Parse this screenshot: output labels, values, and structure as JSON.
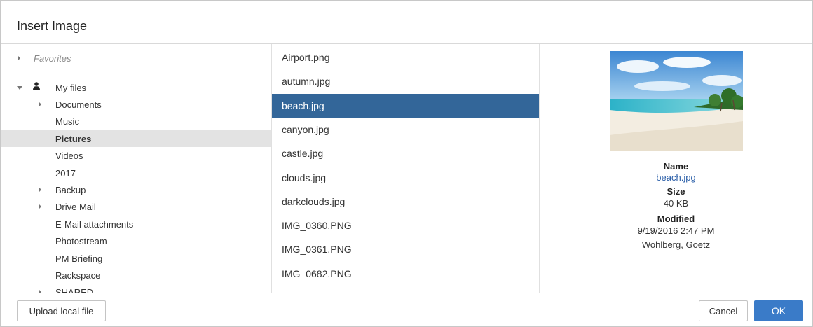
{
  "dialog": {
    "title": "Insert Image"
  },
  "tree": {
    "favorites": "Favorites",
    "my_files": "My files",
    "items": [
      {
        "label": "Documents",
        "caret": true
      },
      {
        "label": "Music",
        "caret": false
      },
      {
        "label": "Pictures",
        "caret": false,
        "selected": true
      },
      {
        "label": "Videos",
        "caret": false
      },
      {
        "label": "2017",
        "caret": false
      },
      {
        "label": "Backup",
        "caret": true
      },
      {
        "label": "Drive Mail",
        "caret": true
      },
      {
        "label": "E-Mail attachments",
        "caret": false
      },
      {
        "label": "Photostream",
        "caret": false
      },
      {
        "label": "PM Briefing",
        "caret": false
      },
      {
        "label": "Rackspace",
        "caret": false
      },
      {
        "label": "SHARED",
        "caret": true
      }
    ]
  },
  "files": [
    "Airport.png",
    "autumn.jpg",
    "beach.jpg",
    "canyon.jpg",
    "castle.jpg",
    "clouds.jpg",
    "darkclouds.jpg",
    "IMG_0360.PNG",
    "IMG_0361.PNG",
    "IMG_0682.PNG"
  ],
  "selected_file": "beach.jpg",
  "preview": {
    "name_label": "Name",
    "name_value": "beach.jpg",
    "size_label": "Size",
    "size_value": "40 KB",
    "modified_label": "Modified",
    "modified_value": "9/19/2016 2:47 PM",
    "modified_by": "Wohlberg, Goetz"
  },
  "footer": {
    "upload_label": "Upload local file",
    "cancel_label": "Cancel",
    "ok_label": "OK"
  },
  "colors": {
    "selection": "#336699",
    "primary_button": "#3a7bc8",
    "link": "#2a5ea8"
  }
}
